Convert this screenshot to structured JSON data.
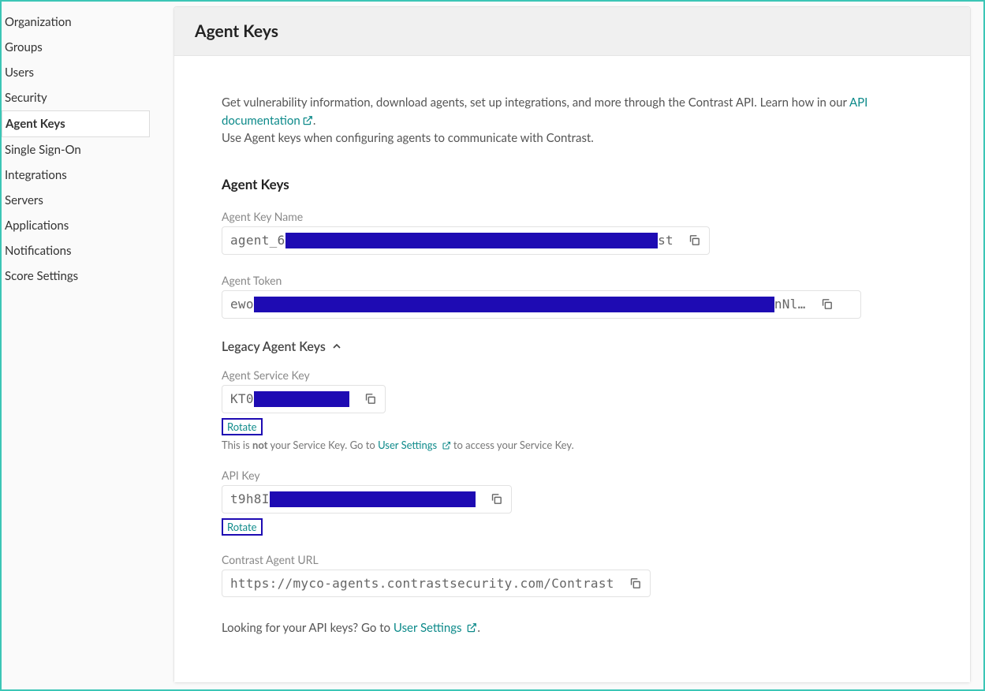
{
  "sidebar": {
    "items": [
      {
        "label": "Organization"
      },
      {
        "label": "Groups"
      },
      {
        "label": "Users"
      },
      {
        "label": "Security"
      },
      {
        "label": "Agent Keys"
      },
      {
        "label": "Single Sign-On"
      },
      {
        "label": "Integrations"
      },
      {
        "label": "Servers"
      },
      {
        "label": "Applications"
      },
      {
        "label": "Notifications"
      },
      {
        "label": "Score Settings"
      }
    ],
    "active_index": 4
  },
  "header": {
    "title": "Agent Keys"
  },
  "intro": {
    "line1_pre": "Get vulnerability information, download agents, set up integrations, and more through the Contrast API. Learn how in our ",
    "link1": "API documentation",
    "line1_post": ".",
    "line2": "Use Agent keys when configuring agents to communicate with Contrast."
  },
  "section_title": "Agent Keys",
  "agent_key_name": {
    "label": "Agent Key Name",
    "prefix": "agent_6",
    "suffix": "st"
  },
  "agent_token": {
    "label": "Agent Token",
    "prefix": "ewo",
    "suffix": "nNl…"
  },
  "legacy_title": "Legacy Agent Keys",
  "service_key": {
    "label": "Agent Service Key",
    "prefix": "KT0",
    "rotate": "Rotate",
    "helper_pre": "This is ",
    "helper_bold": "not",
    "helper_mid": " your Service Key. Go to ",
    "helper_link": "User Settings",
    "helper_post": " to access your Service Key."
  },
  "api_key": {
    "label": "API Key",
    "prefix": "t9h8I",
    "rotate": "Rotate"
  },
  "agent_url": {
    "label": "Contrast Agent URL",
    "value": "https://myco-agents.contrastsecurity.com/Contrast"
  },
  "footer": {
    "pre": "Looking for your API keys? Go to ",
    "link": "User Settings",
    "post": "."
  }
}
